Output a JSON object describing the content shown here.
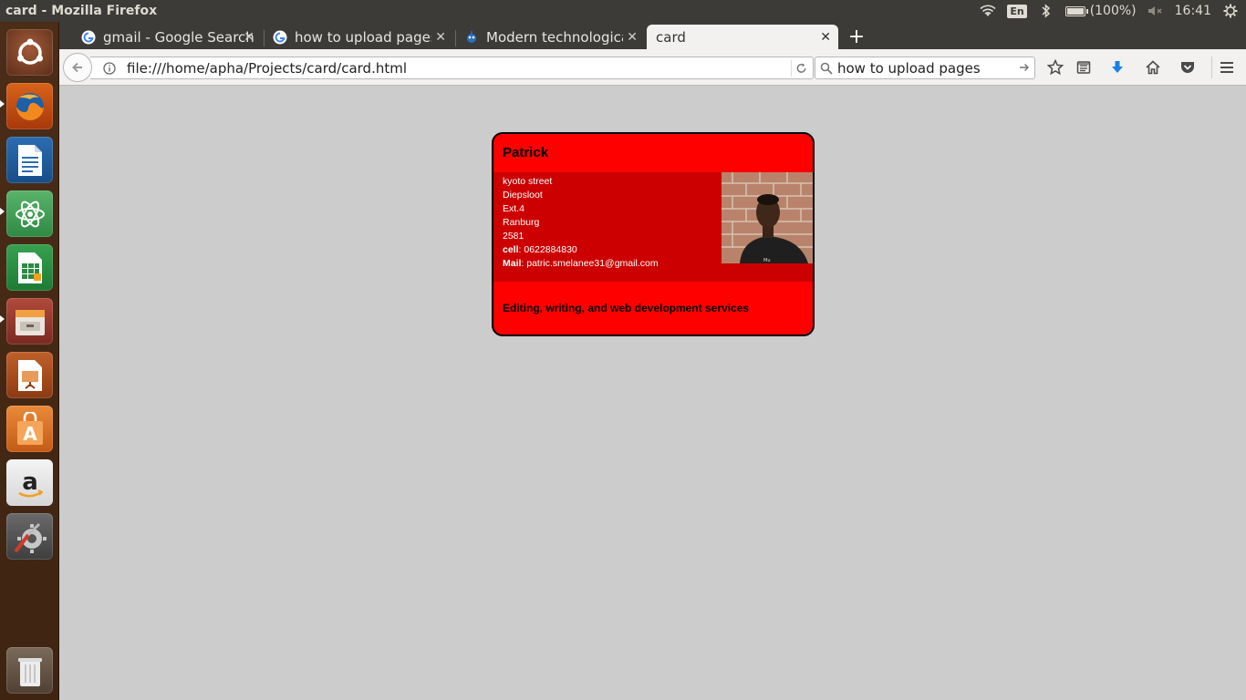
{
  "system_panel": {
    "window_title": "card - Mozilla Firefox",
    "keyboard_layout": "En",
    "battery_text": "(100%)",
    "battery_level": 1.0,
    "clock": "16:41"
  },
  "launcher": {
    "items": [
      {
        "name": "ubuntu-dash-icon"
      },
      {
        "name": "firefox-icon"
      },
      {
        "name": "libreoffice-writer-icon"
      },
      {
        "name": "atom-editor-icon"
      },
      {
        "name": "libreoffice-calc-icon"
      },
      {
        "name": "files-cabinet-icon"
      },
      {
        "name": "libreoffice-impress-icon"
      },
      {
        "name": "software-center-icon"
      },
      {
        "name": "amazon-icon"
      },
      {
        "name": "system-settings-icon"
      },
      {
        "name": "trash-icon"
      }
    ]
  },
  "tabs": [
    {
      "label": "gmail - Google Search",
      "icon": "google-icon",
      "active": false
    },
    {
      "label": "how to upload pages -",
      "icon": "google-icon",
      "active": false
    },
    {
      "label": "Modern technological",
      "icon": "site-favicon",
      "active": false
    },
    {
      "label": "card",
      "icon": "none",
      "active": true
    }
  ],
  "toolbar": {
    "url": "file:///home/apha/Projects/card/card.html",
    "search_value": "how to upload pages"
  },
  "card": {
    "name": "Patrick",
    "address_lines": [
      "kyoto street",
      "Diepsloot",
      "Ext.4",
      "Ranburg",
      "2581"
    ],
    "cell_label": "cell",
    "cell_value": ": 0622884830",
    "mail_label": "Mail",
    "mail_value": ": patric.smelanee31@gmail.com",
    "services": "Editing, writing, and web development services"
  },
  "colors": {
    "card_bg": "#ff0000",
    "card_band": "#cc0000",
    "page_bg": "#cccccc",
    "launcher_bg": "#4b2d18"
  }
}
